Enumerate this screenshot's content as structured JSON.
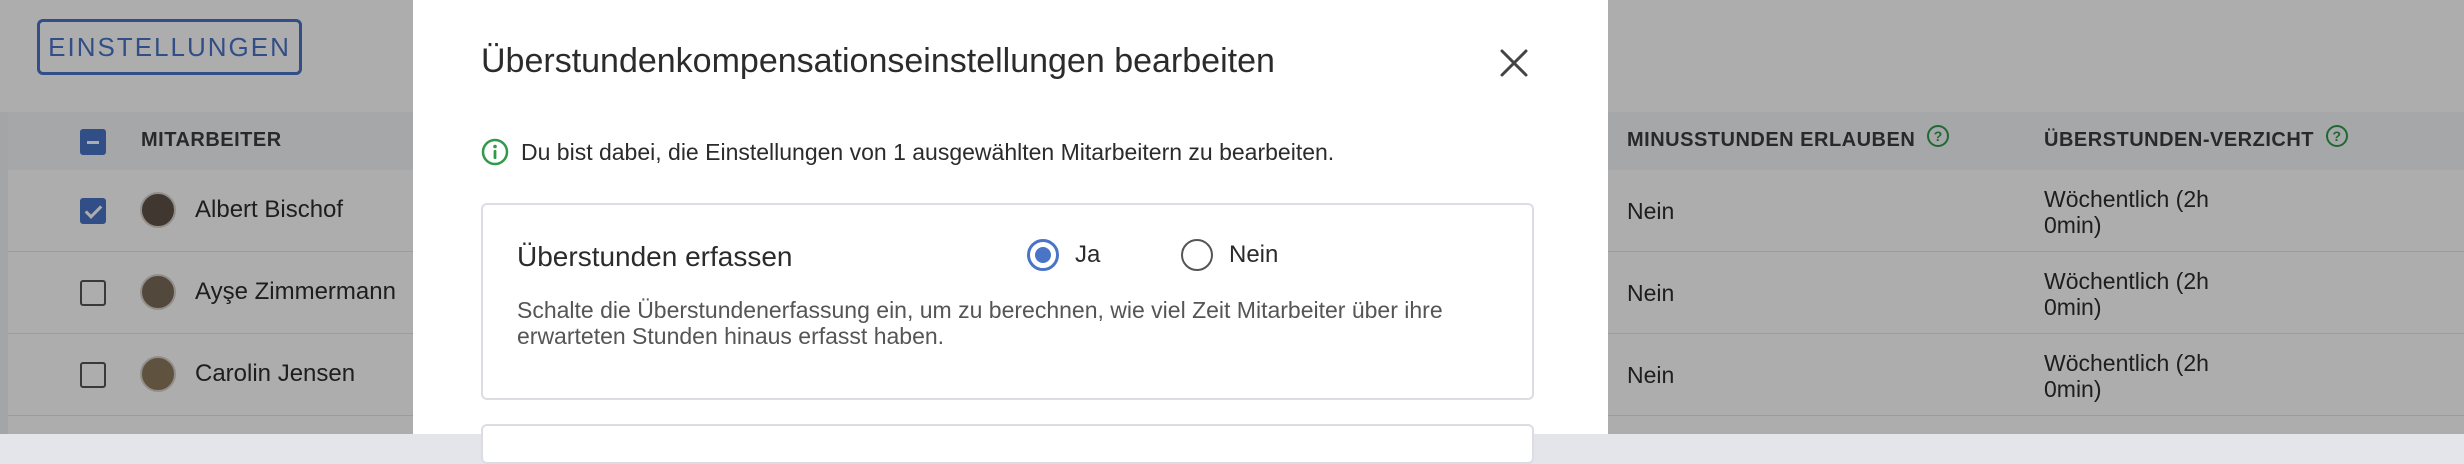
{
  "toolbar": {
    "settings_label": "EINSTELLUNGEN"
  },
  "table": {
    "columns": {
      "employee": "MITARBEITER",
      "allow_minus_hours": "MINUSSTUNDEN ERLAUBEN",
      "overtime_waiver": "ÜBERSTUNDEN-VERZICHT"
    },
    "rows": [
      {
        "name": "Albert Bischof",
        "checked": true,
        "allow_minus_hours": "Nein",
        "overtime_waiver_line1": "Wöchentlich (2h",
        "overtime_waiver_line2": "0min)"
      },
      {
        "name": "Ayşe Zimmermann",
        "checked": false,
        "allow_minus_hours": "Nein",
        "overtime_waiver_line1": "Wöchentlich (2h",
        "overtime_waiver_line2": "0min)"
      },
      {
        "name": "Carolin Jensen",
        "checked": false,
        "allow_minus_hours": "Nein",
        "overtime_waiver_line1": "Wöchentlich (2h",
        "overtime_waiver_line2": "0min)"
      }
    ]
  },
  "modal": {
    "title": "Überstundenkompensationseinstellungen bearbeiten",
    "info": "Du bist dabei, die Einstellungen von 1 ausgewählten Mitarbeitern zu bearbeiten.",
    "setting": {
      "label": "Überstunden erfassen",
      "option_yes": "Ja",
      "option_no": "Nein",
      "selected": "Ja",
      "description": "Schalte die Überstundenerfassung ein, um zu berechnen, wie viel Zeit Mitarbeiter über ihre erwarteten Stunden hinaus erfasst haben."
    }
  },
  "colors": {
    "accent": "#4a74c6",
    "help_green": "#2e9a4a",
    "info_green": "#2e9a4a"
  },
  "icons": {
    "close": "close-icon",
    "info": "info-icon",
    "help": "help-icon"
  }
}
